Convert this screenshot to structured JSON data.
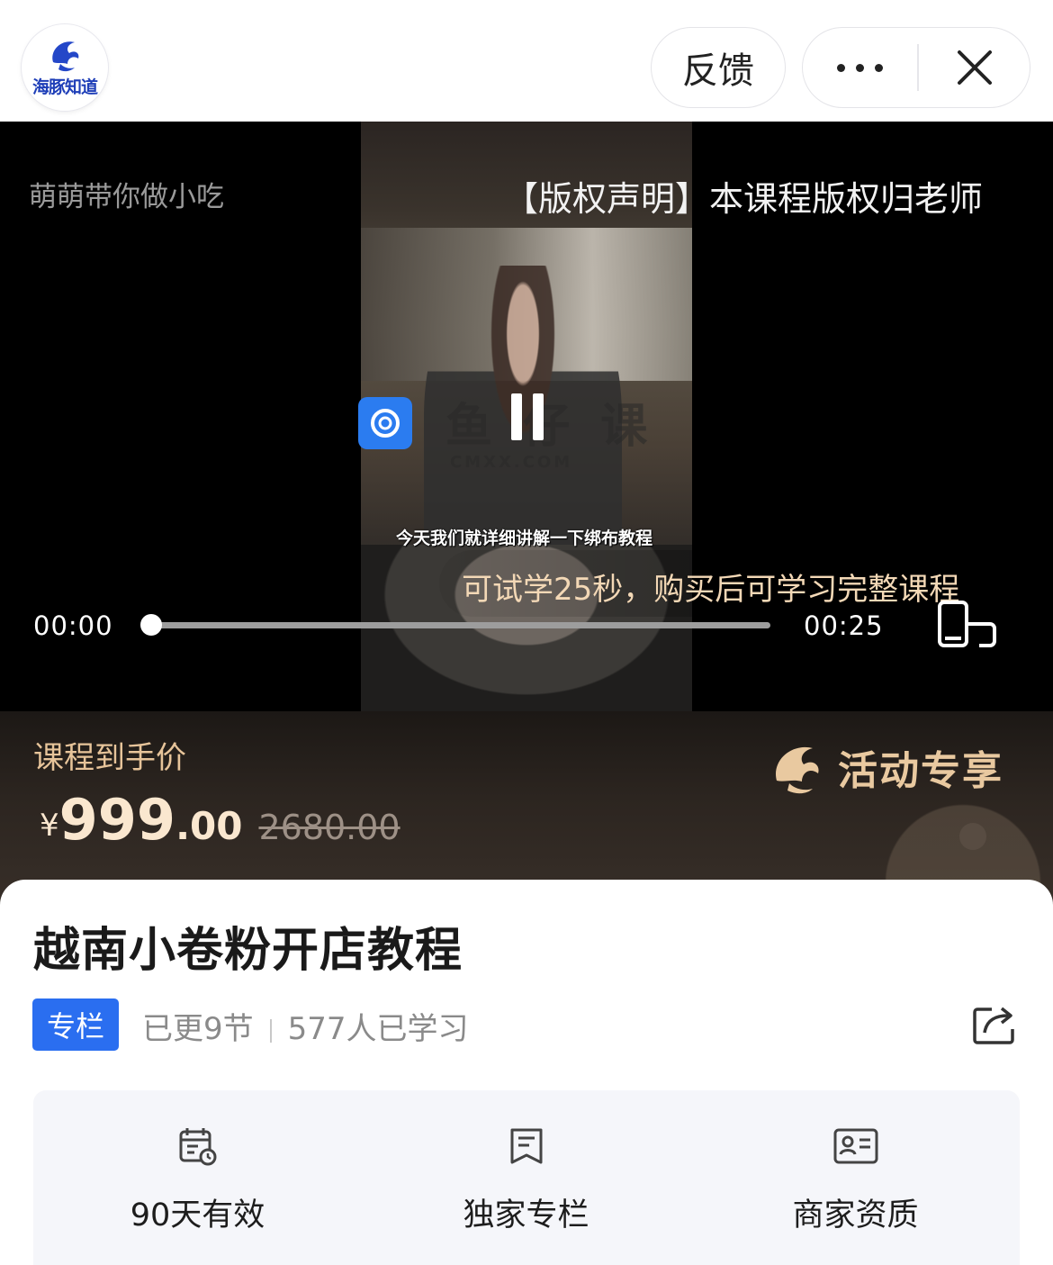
{
  "header": {
    "logo_text": "海豚知道",
    "feedback_label": "反馈",
    "more_icon": "more-dots-icon",
    "close_icon": "close-icon"
  },
  "video": {
    "channel_name": "萌萌带你做小吃",
    "copyright_notice": "【版权声明】本课程版权归老师",
    "caption": "今天我们就详细讲解一下绑布教程",
    "watermark_text": "鱼 仔 课",
    "watermark_sub": "CMXX.COM",
    "trial_tip": "可试学25秒，购买后可学习完整课程",
    "current_time": "00:00",
    "total_time": "00:25",
    "progress": 0
  },
  "price": {
    "label": "课程到手价",
    "currency": "¥",
    "price_int": "999",
    "price_dec": ".00",
    "original_price": "2680.00",
    "activity_label": "活动专享"
  },
  "course": {
    "title": "越南小卷粉开店教程",
    "tag": "专栏",
    "updated": "已更9节",
    "learners": "577人已学习"
  },
  "features": [
    {
      "icon": "calendar-clock-icon",
      "label": "90天有效"
    },
    {
      "icon": "bookmark-doc-icon",
      "label": "独家专栏"
    },
    {
      "icon": "id-card-icon",
      "label": "商家资质"
    }
  ],
  "colors": {
    "accent_blue": "#2a6ef0",
    "price_gold": "#e7c49a",
    "trial_text": "#f3d8b6"
  }
}
